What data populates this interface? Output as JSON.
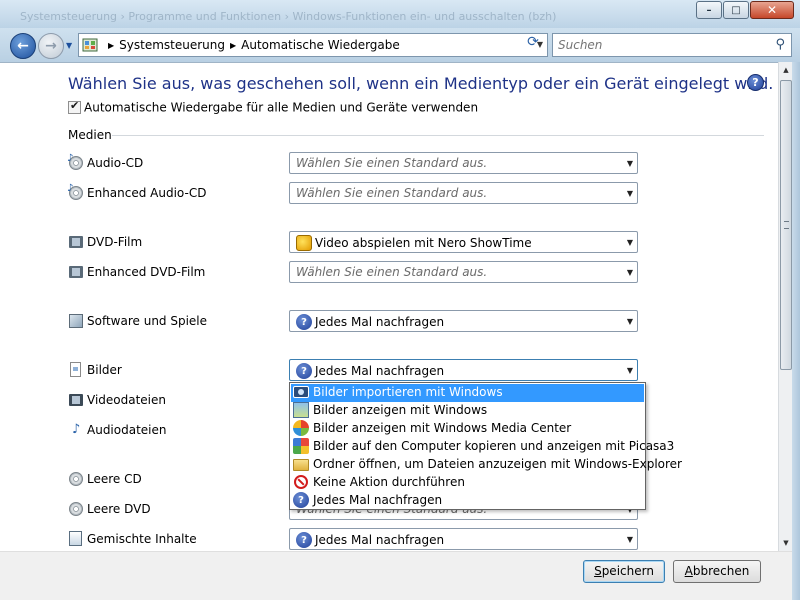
{
  "titlebar": {
    "ghost_text": "Systemsteuerung › Programme und Funktionen › Windows-Funktionen ein- und ausschalten (bzh)",
    "minimize_glyph": "–",
    "maximize_glyph": "□",
    "close_glyph": "✕"
  },
  "nav": {
    "back_glyph": "←",
    "forward_glyph": "→",
    "breadcrumb": [
      "Systemsteuerung",
      "Automatische Wiedergabe"
    ],
    "refresh_glyph": "⟳",
    "search_placeholder": "Suchen",
    "search_glyph": "⚲"
  },
  "main": {
    "heading": "Wählen Sie aus, was geschehen soll, wenn ein Medientyp oder ein Gerät eingelegt wird.",
    "help_glyph": "?",
    "autoplay_checkbox": {
      "label": "Automatische Wiedergabe für alle Medien und Geräte verwenden",
      "checked": true,
      "mark": "✔"
    },
    "section_title": "Medien",
    "rows": [
      {
        "label": "Audio-CD",
        "icon": "audio-cd-icon",
        "value": "Wählen Sie einen Standard aus.",
        "placeholder": true
      },
      {
        "label": "Enhanced Audio-CD",
        "icon": "audio-cd-icon",
        "value": "Wählen Sie einen Standard aus.",
        "placeholder": true
      },
      {
        "label": "DVD-Film",
        "icon": "dvd-film-icon",
        "value": "Video abspielen mit Nero ShowTime",
        "placeholder": false,
        "value_icon": "nero-showtime-icon"
      },
      {
        "label": "Enhanced DVD-Film",
        "icon": "dvd-film-icon",
        "value": "Wählen Sie einen Standard aus.",
        "placeholder": true
      },
      {
        "label": "Software und Spiele",
        "icon": "software-icon",
        "value": "Jedes Mal nachfragen",
        "placeholder": false,
        "value_icon": "question-icon"
      },
      {
        "label": "Bilder",
        "icon": "pictures-icon",
        "value": "Jedes Mal nachfragen",
        "placeholder": false,
        "value_icon": "question-icon",
        "open": true
      },
      {
        "label": "Videodateien",
        "icon": "video-files-icon"
      },
      {
        "label": "Audiodateien",
        "icon": "audio-files-icon"
      },
      {
        "label": "Leere CD",
        "icon": "blank-cd-icon"
      },
      {
        "label": "Leere DVD",
        "icon": "blank-dvd-icon",
        "value": "Wählen Sie einen Standard aus.",
        "placeholder": true
      },
      {
        "label": "Gemischte Inhalte",
        "icon": "mixed-content-icon",
        "value": "Jedes Mal nachfragen",
        "placeholder": false,
        "value_icon": "question-icon"
      }
    ],
    "dropdown_options": [
      {
        "label": "Bilder importieren mit Windows",
        "icon": "camera-import-icon",
        "selected": true
      },
      {
        "label": "Bilder anzeigen mit Windows",
        "icon": "photo-gallery-icon",
        "selected": false
      },
      {
        "label": "Bilder anzeigen mit Windows Media Center",
        "icon": "media-center-icon",
        "selected": false
      },
      {
        "label": "Bilder auf den Computer kopieren und anzeigen mit Picasa3",
        "icon": "picasa-icon",
        "selected": false
      },
      {
        "label": "Ordner öffnen, um Dateien anzuzeigen mit Windows-Explorer",
        "icon": "folder-icon",
        "selected": false
      },
      {
        "label": "Keine Aktion durchführen",
        "icon": "no-action-icon",
        "selected": false
      },
      {
        "label": "Jedes Mal nachfragen",
        "icon": "question-icon",
        "selected": false
      }
    ]
  },
  "footer": {
    "save_label": "Speichern",
    "save_mnemonic": "S",
    "save_rest": "peichern",
    "cancel_label": "Abbrechen",
    "cancel_mnemonic": "A",
    "cancel_rest": "bbrechen"
  },
  "colors": {
    "heading": "#1e3287",
    "selection": "#3399ff",
    "frame": "#cfe0ee"
  }
}
